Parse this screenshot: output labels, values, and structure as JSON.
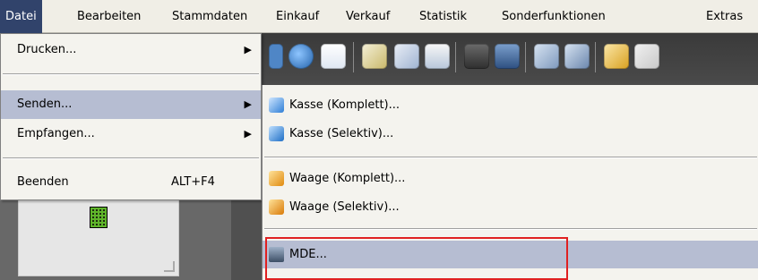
{
  "menubar": {
    "items": [
      "Datei",
      "Bearbeiten",
      "Stammdaten",
      "Einkauf",
      "Verkauf",
      "Statistik",
      "Sonderfunktionen",
      "Extras"
    ]
  },
  "datei_menu": {
    "drucken": "Drucken...",
    "senden": "Senden...",
    "empfangen": "Empfangen...",
    "beenden": "Beenden",
    "beenden_shortcut": "ALT+F4"
  },
  "senden_menu": {
    "items": [
      {
        "label": "Kasse (Komplett)...",
        "icon": "cash-register-icon"
      },
      {
        "label": "Kasse (Selektiv)...",
        "icon": "cash-register-icon"
      },
      {
        "label": "Waage (Komplett)...",
        "icon": "scale-icon"
      },
      {
        "label": "Waage (Selektiv)...",
        "icon": "scale-icon"
      },
      {
        "label": "MDE...",
        "icon": "mobile-data-device-icon"
      }
    ]
  },
  "colors": {
    "menubar_active": "#31436b",
    "menu_highlight": "#b6bdd2",
    "focus_outline": "#e02020"
  }
}
